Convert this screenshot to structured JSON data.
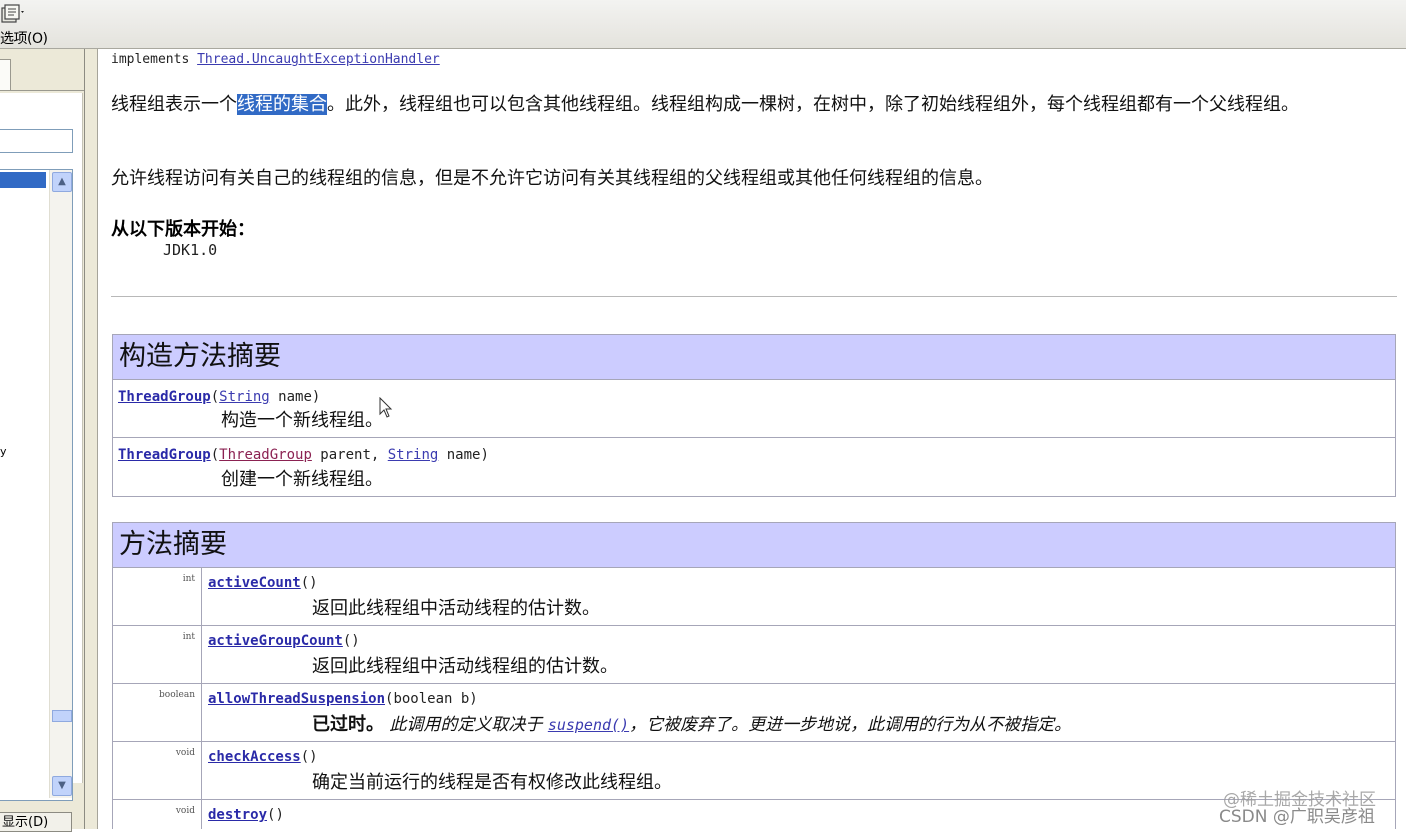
{
  "toolbar": {
    "options_label": "选项(O)",
    "options_icon": "options-icon"
  },
  "left_pane": {
    "truncated_item": "y",
    "bottom_button_label": "显示(D)"
  },
  "doc": {
    "implements_prefix": "implements",
    "implements_link": "Thread.UncaughtExceptionHandler",
    "para1_before": "线程组表示一个",
    "para1_highlight": "线程的集合",
    "para1_after": "。此外，线程组也可以包含其他线程组。线程组构成一棵树，在树中，除了初始线程组外，每个线程组都有一个父线程组。",
    "para2": "允许线程访问有关自己的线程组的信息，但是不允许它访问有关其线程组的父线程组或其他任何线程组的信息。",
    "since_label": "从以下版本开始：",
    "since_value": "JDK1.0"
  },
  "constructors": {
    "header": "构造方法摘要",
    "rows": [
      {
        "name": "ThreadGroup",
        "open": "(",
        "param1_type": "String",
        "param1_name": " name)",
        "desc": "构造一个新线程组。"
      },
      {
        "name": "ThreadGroup",
        "open": "(",
        "param1_type": "ThreadGroup",
        "param1_name": " parent, ",
        "param2_type": "String",
        "param2_name": " name)",
        "desc": "创建一个新线程组。"
      }
    ]
  },
  "methods": {
    "header": "方法摘要",
    "rows": [
      {
        "ret": "int",
        "name": "activeCount",
        "params": "()",
        "desc": "返回此线程组中活动线程的估计数。"
      },
      {
        "ret": "int",
        "name": "activeGroupCount",
        "params": "()",
        "desc": "返回此线程组中活动线程组的估计数。"
      },
      {
        "ret": "boolean",
        "name": "allowThreadSuspension",
        "params": "(boolean b)",
        "deprecated_label": "已过时。",
        "deprecated_before": " 此调用的定义取决于 ",
        "deprecated_link": "suspend()",
        "deprecated_after": "，它被废弃了。更进一步地说，此调用的行为从不被指定。"
      },
      {
        "ret": "void",
        "name": "checkAccess",
        "params": "()",
        "desc": "确定当前运行的线程是否有权修改此线程组。"
      },
      {
        "ret": "void",
        "name": "destroy",
        "params": "()",
        "desc": ""
      }
    ]
  },
  "watermark": {
    "line1": "@稀土掘金技术社区",
    "line2": "CSDN @广职吴彦祖"
  },
  "colors": {
    "header_bg": "#ccccff",
    "link": "#2a2aa8",
    "selection": "#316ac5"
  }
}
